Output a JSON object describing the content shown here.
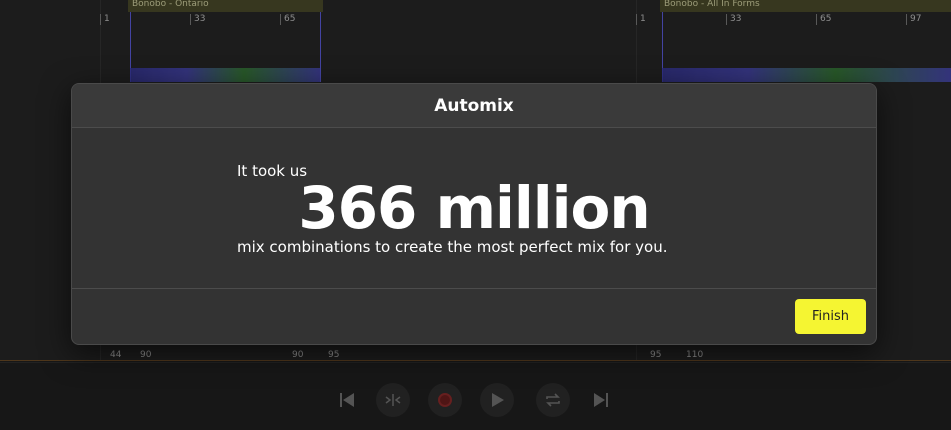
{
  "tracks": {
    "clip_a": {
      "title": "Bonobo - Ontario",
      "ruler": [
        "1",
        "33",
        "65"
      ]
    },
    "clip_b": {
      "title": "Bonobo - All In Forms",
      "ruler": [
        "1",
        "33",
        "65",
        "97"
      ]
    }
  },
  "timeline": {
    "labels": [
      "44",
      "90",
      "90",
      "95",
      "95",
      "110"
    ]
  },
  "transport": {
    "icons": [
      "skip-back-icon",
      "split-icon",
      "record-icon",
      "play-icon",
      "loop-icon",
      "skip-forward-icon"
    ]
  },
  "modal": {
    "title": "Automix",
    "line1": "It took us",
    "headline": "366 million",
    "line3": "mix combinations to create the most perfect mix for you.",
    "finish_label": "Finish"
  },
  "colors": {
    "accent": "#f5f532",
    "modal_bg": "#333333"
  }
}
